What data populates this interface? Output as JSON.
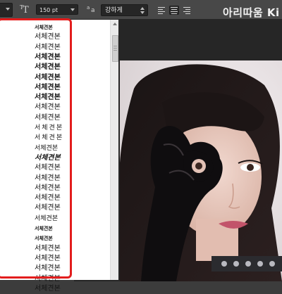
{
  "options_bar": {
    "font_size_value": "150 pt",
    "antialias_value": "강하게",
    "watermark_text": "아리따움 Ki"
  },
  "font_list": {
    "items": [
      {
        "label": "서체견본",
        "style": "tiny"
      },
      {
        "label": "서체견본",
        "style": "regular"
      },
      {
        "label": "서체견본",
        "style": "regular"
      },
      {
        "label": "서체견본",
        "style": "bold"
      },
      {
        "label": "서체견본",
        "style": "bold"
      },
      {
        "label": "서체견본",
        "style": "bold"
      },
      {
        "label": "서체견본",
        "style": "bold"
      },
      {
        "label": "서체견본",
        "style": "bold"
      },
      {
        "label": "서체견본",
        "style": "regular"
      },
      {
        "label": "서체견본",
        "style": "regular"
      },
      {
        "label": "서체견본",
        "style": "spaced"
      },
      {
        "label": "서체견본",
        "style": "spaced"
      },
      {
        "label": "서체견본",
        "style": "hand"
      },
      {
        "label": "서체견본",
        "style": "italic"
      },
      {
        "label": "서체견본",
        "style": "regular"
      },
      {
        "label": "서체견본",
        "style": "regular"
      },
      {
        "label": "서체견본",
        "style": "regular"
      },
      {
        "label": "서체견본",
        "style": "regular"
      },
      {
        "label": "서체견본",
        "style": "regular"
      },
      {
        "label": "서체견본",
        "style": "hand"
      },
      {
        "label": "서체견본",
        "style": "tiny"
      },
      {
        "label": "서체견본",
        "style": "tiny"
      },
      {
        "label": "서체견본",
        "style": "regular"
      },
      {
        "label": "서체견본",
        "style": "regular"
      },
      {
        "label": "서체견본",
        "style": "regular"
      },
      {
        "label": "서체견본",
        "style": "regular"
      },
      {
        "label": "서체견본",
        "style": "regular"
      }
    ]
  },
  "colors": {
    "toolbar": "#484848",
    "highlight_border": "#e21d1d",
    "document_bg": "#262626"
  }
}
